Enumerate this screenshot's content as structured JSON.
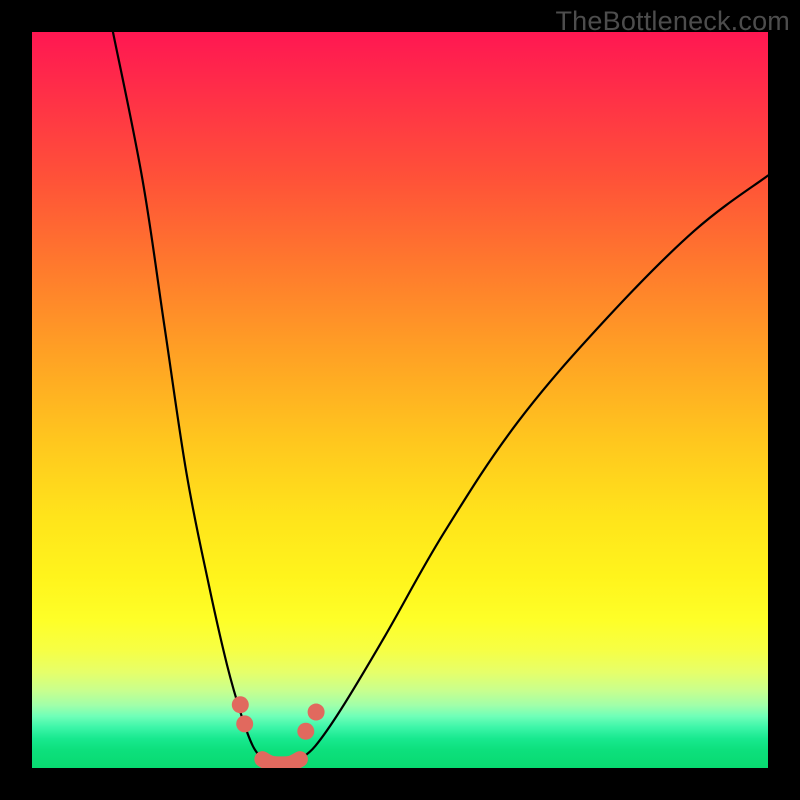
{
  "watermark": "TheBottleneck.com",
  "chart_data": {
    "type": "line",
    "title": "",
    "xlabel": "",
    "ylabel": "",
    "xlim": [
      0,
      100
    ],
    "ylim": [
      0,
      100
    ],
    "grid": false,
    "legend": false,
    "notes": "Gradient background from magenta/red (top, high bottleneck) through orange/yellow to green (bottom, optimal). A V-shaped black curve dips to the baseline. A salmon trough segment and dots mark the balanced zone near the minimum.",
    "series": [
      {
        "name": "left-arm",
        "x": [
          11,
          15,
          18,
          21,
          24,
          26.5,
          28.5,
          30,
          31.3
        ],
        "y": [
          100,
          80,
          60,
          40,
          25,
          14,
          7,
          3,
          1.2
        ]
      },
      {
        "name": "right-arm",
        "x": [
          36.4,
          38.5,
          42,
          48,
          56,
          66,
          78,
          90,
          100
        ],
        "y": [
          1.2,
          3,
          8,
          18,
          32,
          47,
          61,
          73,
          80.5
        ]
      },
      {
        "name": "trough",
        "x": [
          31.3,
          32.5,
          34,
          35.2,
          36.4
        ],
        "y": [
          1.2,
          0.6,
          0.5,
          0.6,
          1.2
        ]
      }
    ],
    "markers": [
      {
        "name": "left-upper-dot",
        "x": 28.3,
        "y": 8.6
      },
      {
        "name": "left-lower-dot",
        "x": 28.9,
        "y": 6.0
      },
      {
        "name": "right-lower-dot",
        "x": 37.2,
        "y": 5.0
      },
      {
        "name": "right-upper-dot",
        "x": 38.6,
        "y": 7.6
      }
    ]
  }
}
